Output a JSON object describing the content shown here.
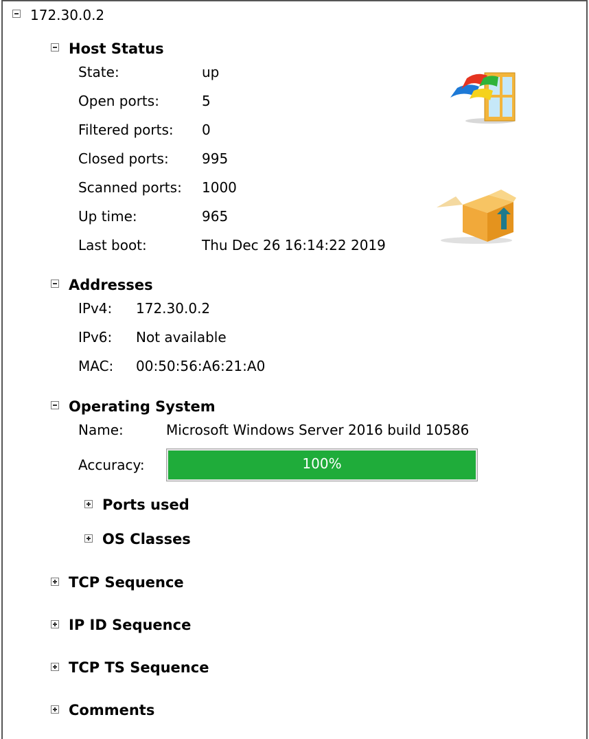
{
  "host": {
    "title": "172.30.0.2"
  },
  "host_status": {
    "title": "Host Status",
    "rows": [
      {
        "label": "State:",
        "value": "up"
      },
      {
        "label": "Open ports:",
        "value": "5"
      },
      {
        "label": "Filtered ports:",
        "value": "0"
      },
      {
        "label": "Closed ports:",
        "value": "995"
      },
      {
        "label": "Scanned ports:",
        "value": "1000"
      },
      {
        "label": "Up time:",
        "value": "965"
      },
      {
        "label": "Last boot:",
        "value": "Thu Dec 26 16:14:22 2019"
      }
    ],
    "icons": [
      "windows-os-icon",
      "open-box-upload-icon"
    ]
  },
  "addresses": {
    "title": "Addresses",
    "rows": [
      {
        "label": "IPv4:",
        "value": "172.30.0.2"
      },
      {
        "label": "IPv6:",
        "value": "Not available"
      },
      {
        "label": "MAC:",
        "value": "00:50:56:A6:21:A0"
      }
    ]
  },
  "os": {
    "title": "Operating System",
    "name_label": "Name:",
    "name_value": "Microsoft Windows Server 2016 build 10586",
    "accuracy_label": "Accuracy:",
    "accuracy_text": "100%",
    "accuracy_fraction": 1.0,
    "accuracy_color": "#1fac3a",
    "ports_used": "Ports used",
    "os_classes": "OS Classes"
  },
  "sections": {
    "tcp_sequence": "TCP Sequence",
    "ip_id_sequence": "IP ID Sequence",
    "tcp_ts_sequence": "TCP TS Sequence",
    "comments": "Comments"
  }
}
